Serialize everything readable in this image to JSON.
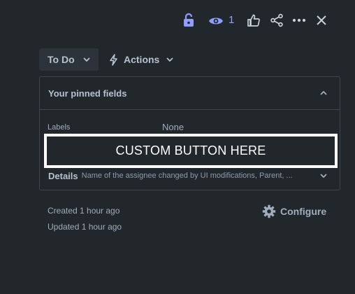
{
  "header": {
    "watch_count": "1"
  },
  "icons": {
    "lock": "unlocked-padlock-icon",
    "watch": "eye-icon",
    "like": "thumbs-up-icon",
    "share": "share-icon",
    "more": "more-horizontal-icon",
    "close": "close-icon",
    "actions": "lightning-icon",
    "configure": "gear-icon"
  },
  "colors": {
    "background": "#22272b",
    "accent": "#8f9fff",
    "panel_border": "#3d454d",
    "status_button_bg": "#2c333a"
  },
  "toolbar": {
    "status_label": "To Do",
    "actions_label": "Actions"
  },
  "pinned": {
    "title": "Your pinned fields",
    "field_label": "Labels",
    "field_value": "None"
  },
  "custom_button": {
    "label": "CUSTOM BUTTON HERE"
  },
  "details": {
    "title": "Details",
    "summary": "Name of the assignee changed by UI modifications, Parent, ..."
  },
  "meta": {
    "created": "Created 1 hour ago",
    "updated": "Updated 1 hour ago"
  },
  "configure": {
    "label": "Configure"
  }
}
